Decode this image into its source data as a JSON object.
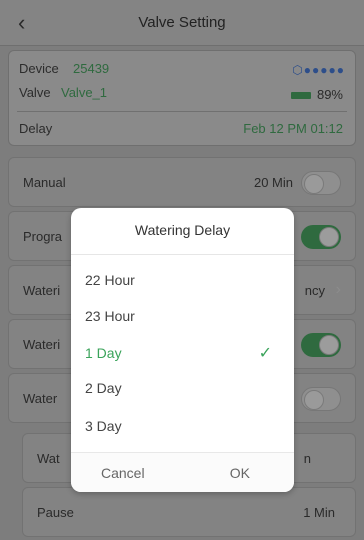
{
  "header": {
    "title": "Valve Setting",
    "back_icon": "chevron-left-icon"
  },
  "device": {
    "device_label": "Device",
    "device_id": "25439",
    "valve_label": "Valve",
    "valve_name": "Valve_1",
    "delay_label": "Delay",
    "delay_value": "Feb 12 PM 01:12",
    "signal_icon": "bluetooth-signal-icon",
    "battery_percent": "89%"
  },
  "rows": {
    "manual": {
      "label": "Manual",
      "value": "20 Min"
    },
    "program": {
      "label": "Progra"
    },
    "watering_freq": {
      "label": "Wateri",
      "value": "ncy"
    },
    "watering2": {
      "label": "Wateri"
    },
    "water3": {
      "label": "Water"
    },
    "wat4": {
      "label": "Wat",
      "value": "n"
    },
    "pause": {
      "label": "Pause",
      "value": "1 Min"
    }
  },
  "modal": {
    "title": "Watering Delay",
    "options": [
      "22 Hour",
      "23 Hour",
      "1 Day",
      "2 Day",
      "3 Day"
    ],
    "selected": "1 Day",
    "cancel": "Cancel",
    "ok": "OK"
  },
  "colors": {
    "accent": "#3aa35a",
    "overlay": "#7d7d7d"
  }
}
